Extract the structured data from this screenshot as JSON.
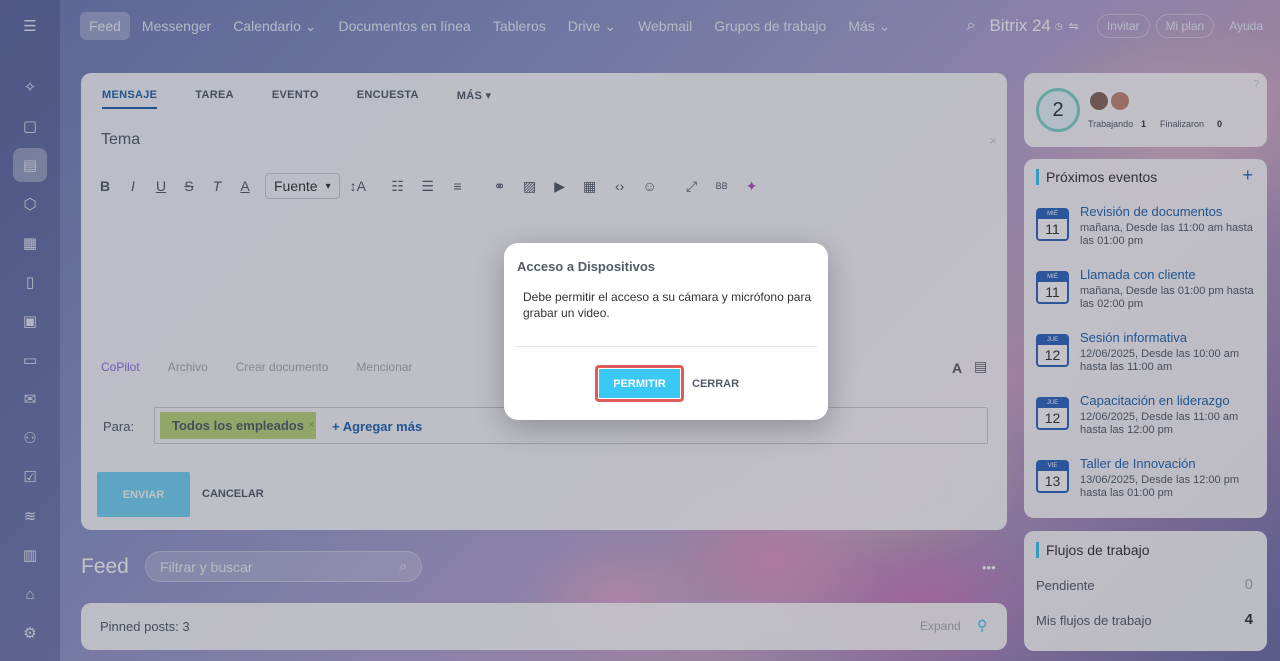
{
  "nav": {
    "items": [
      "Feed",
      "Messenger",
      "Calendario ⌄",
      "Documentos en línea",
      "Tableros",
      "Drive ⌄",
      "Webmail",
      "Grupos de trabajo",
      "Más ⌄"
    ],
    "brand": "Bitrix 24",
    "invite": "Invitar",
    "plan": "Mi plan",
    "help": "Ayuda"
  },
  "composer": {
    "tabs": [
      "MENSAJE",
      "TAREA",
      "EVENTO",
      "ENCUESTA",
      "MÁS ▾"
    ],
    "topic_placeholder": "Tema",
    "font_select": "Fuente",
    "attach": [
      "CoPilot",
      "Archivo",
      "Crear documento",
      "Mencionar",
      "video"
    ],
    "to_label": "Para:",
    "recipient": "Todos los empleados",
    "add_more": "+ Agregar más",
    "send": "ENVIAR",
    "cancel": "CANCELAR"
  },
  "feed": {
    "title": "Feed",
    "search_placeholder": "Filtrar y buscar",
    "pinned": "Pinned posts: 3",
    "expand": "Expand"
  },
  "dialog": {
    "title": "Acceso a Dispositivos",
    "body": "Debe permitir el acceso a su cámara y micrófono para grabar un video.",
    "permit": "PERMITIR",
    "close": "CERRAR"
  },
  "workday": {
    "count": "2",
    "working_label": "Trabajando",
    "working_count": "1",
    "finished_label": "Finalizaron",
    "finished_count": "0"
  },
  "events": {
    "title": "Próximos eventos",
    "items": [
      {
        "month": "MIÉ",
        "day": "11",
        "title": "Revisión de documentos",
        "sub": "mañana, Desde las 11:00 am hasta las 01:00 pm"
      },
      {
        "month": "MIÉ",
        "day": "11",
        "title": "Llamada con cliente",
        "sub": "mañana, Desde las 01:00 pm hasta las 02:00 pm"
      },
      {
        "month": "JUE",
        "day": "12",
        "title": "Sesión informativa",
        "sub": "12/06/2025, Desde las 10:00 am hasta las 11:00 am"
      },
      {
        "month": "JUE",
        "day": "12",
        "title": "Capacitación en liderazgo",
        "sub": "12/06/2025, Desde las 11:00 am hasta las 12:00 pm"
      },
      {
        "month": "VIE",
        "day": "13",
        "title": "Taller de Innovación",
        "sub": "13/06/2025, Desde las 12:00 pm hasta las 01:00 pm"
      }
    ]
  },
  "workflows": {
    "title": "Flujos de trabajo",
    "pending_label": "Pendiente",
    "pending": "0",
    "mine_label": "Mis flujos de trabajo",
    "mine": "4"
  },
  "colors": {
    "accent": "#3bc8f5",
    "link": "#2067b0",
    "highlight": "#e05a5a"
  }
}
